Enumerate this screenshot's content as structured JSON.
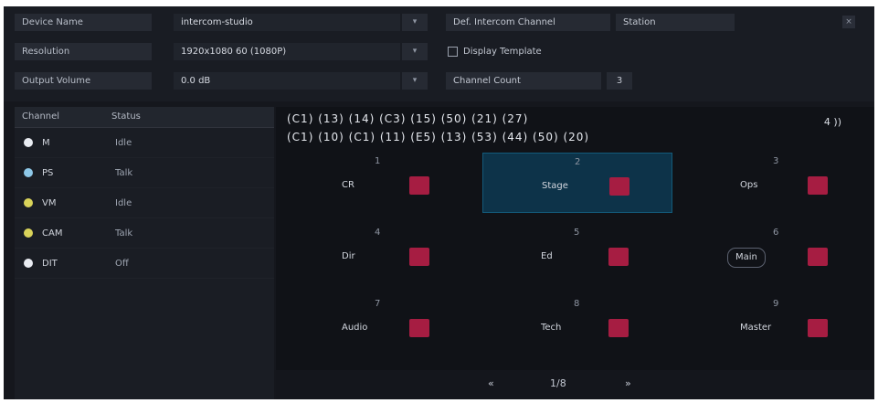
{
  "settings": {
    "device_name_label": "Device Name",
    "device_name_value": "intercom-studio",
    "resolution_label": "Resolution",
    "resolution_value": "1920x1080 60 (1080P)",
    "volume_label": "Output Volume",
    "volume_value": "0.0 dB",
    "default_channel_label": "Def. Intercom Channel",
    "default_channel_value": "Station",
    "display_layout_label": "Display Template",
    "channel_count_label": "Channel Count",
    "channel_count_value": "3"
  },
  "monitor_list": {
    "headers": [
      "Channel",
      "Status"
    ],
    "rows": [
      {
        "name": "M",
        "status": "Idle",
        "color": "#e9ecf2"
      },
      {
        "name": "PS",
        "status": "Talk",
        "color": "#8ec8e8"
      },
      {
        "name": "VM",
        "status": "Idle",
        "color": "#d9d35a"
      },
      {
        "name": "CAM",
        "status": "Talk",
        "color": "#d9d35a"
      },
      {
        "name": "DIT",
        "status": "Off",
        "color": "#e9ecf2"
      }
    ]
  },
  "video_area": {
    "id_line_1": "(C1) (13) (14) (C3) (15) (50) (21) (27)",
    "id_line_2": "(C1) (10) (C1) (11) (E5) (13) (53) (44) (50) (20)",
    "volume_indicator": "4 ))"
  },
  "grid": [
    {
      "num": "1",
      "name": "CR",
      "active": false,
      "style": "text"
    },
    {
      "num": "2",
      "name": "Stage",
      "active": true,
      "style": "text"
    },
    {
      "num": "3",
      "name": "Ops",
      "active": false,
      "style": "text"
    },
    {
      "num": "4",
      "name": "Dir",
      "active": false,
      "style": "text"
    },
    {
      "num": "5",
      "name": "Ed",
      "active": false,
      "style": "text"
    },
    {
      "num": "6",
      "name": "Main",
      "active": false,
      "style": "pill"
    },
    {
      "num": "7",
      "name": "Audio",
      "active": false,
      "style": "text"
    },
    {
      "num": "8",
      "name": "Tech",
      "active": false,
      "style": "text"
    },
    {
      "num": "9",
      "name": "Master",
      "active": false,
      "style": "text"
    }
  ],
  "bottom_controls": {
    "prev": "«",
    "page": "1/8",
    "next": "»"
  }
}
